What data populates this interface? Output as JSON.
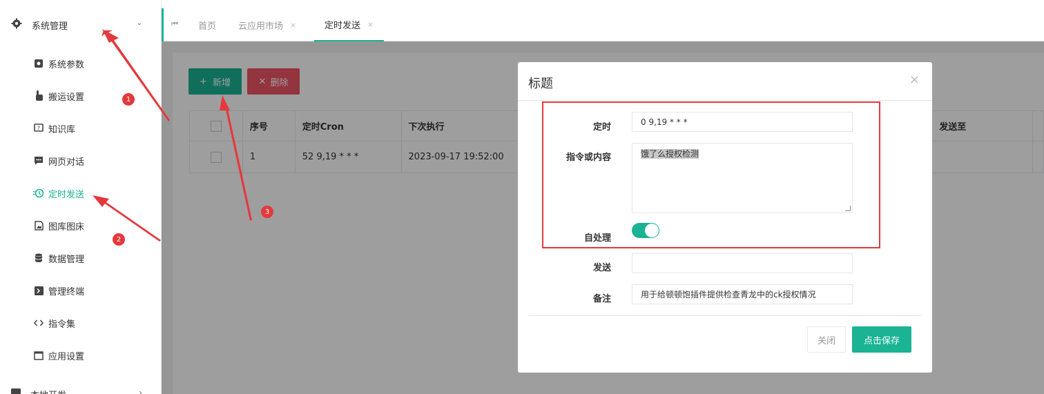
{
  "sidebar": {
    "parent": {
      "label": "系统管理",
      "icon": "gear-icon",
      "expanded": true
    },
    "items": [
      {
        "label": "系统参数",
        "icon": "settings-square-icon",
        "active": false
      },
      {
        "label": "搬运设置",
        "icon": "hand-pointer-icon",
        "active": false
      },
      {
        "label": "知识库",
        "icon": "question-chat-icon",
        "active": false
      },
      {
        "label": "网页对话",
        "icon": "chat-icon",
        "active": false
      },
      {
        "label": "定时发送",
        "icon": "clock-history-icon",
        "active": true
      },
      {
        "label": "图库图床",
        "icon": "image-file-icon",
        "active": false
      },
      {
        "label": "数据管理",
        "icon": "database-icon",
        "active": false
      },
      {
        "label": "管理终端",
        "icon": "terminal-icon",
        "active": false
      },
      {
        "label": "指令集",
        "icon": "code-icon",
        "active": false
      },
      {
        "label": "应用设置",
        "icon": "window-icon",
        "active": false
      }
    ],
    "next_parent": {
      "label": "本地开发"
    }
  },
  "tabs": {
    "items": [
      {
        "label": "首页",
        "closable": false,
        "active": false
      },
      {
        "label": "云应用市场",
        "closable": true,
        "active": false
      },
      {
        "label": "定时发送",
        "closable": true,
        "active": true
      }
    ],
    "close_glyph": "×"
  },
  "toolbar": {
    "add_label": "新增",
    "add_icon": "+",
    "delete_label": "删除",
    "delete_icon": "✕"
  },
  "table": {
    "columns": [
      "序号",
      "定时Cron",
      "下次执行",
      "发送至"
    ],
    "rows": [
      {
        "index": "1",
        "cron": "52 9,19 * * *",
        "next_run": "2023-09-17 19:52:00",
        "send_to": ""
      }
    ]
  },
  "modal": {
    "title": "标题",
    "close_glyph": "×",
    "fields": {
      "schedule": {
        "label": "定时",
        "value": "0 9,19 * * *"
      },
      "content": {
        "label": "指令或内容",
        "value": "饿了么授权检测"
      },
      "self_process": {
        "label": "自处理",
        "on": true
      },
      "send": {
        "label": "发送",
        "value": ""
      },
      "remark": {
        "label": "备注",
        "value": "用于给顿顿饱插件提供检查青龙中的ck授权情况"
      }
    },
    "close_label": "关闭",
    "save_label": "点击保存"
  },
  "annotations": {
    "badges": [
      "1",
      "2",
      "3"
    ]
  },
  "colors": {
    "primary": "#1ab394",
    "danger": "#ed5565",
    "annotation": "#e4393c"
  }
}
